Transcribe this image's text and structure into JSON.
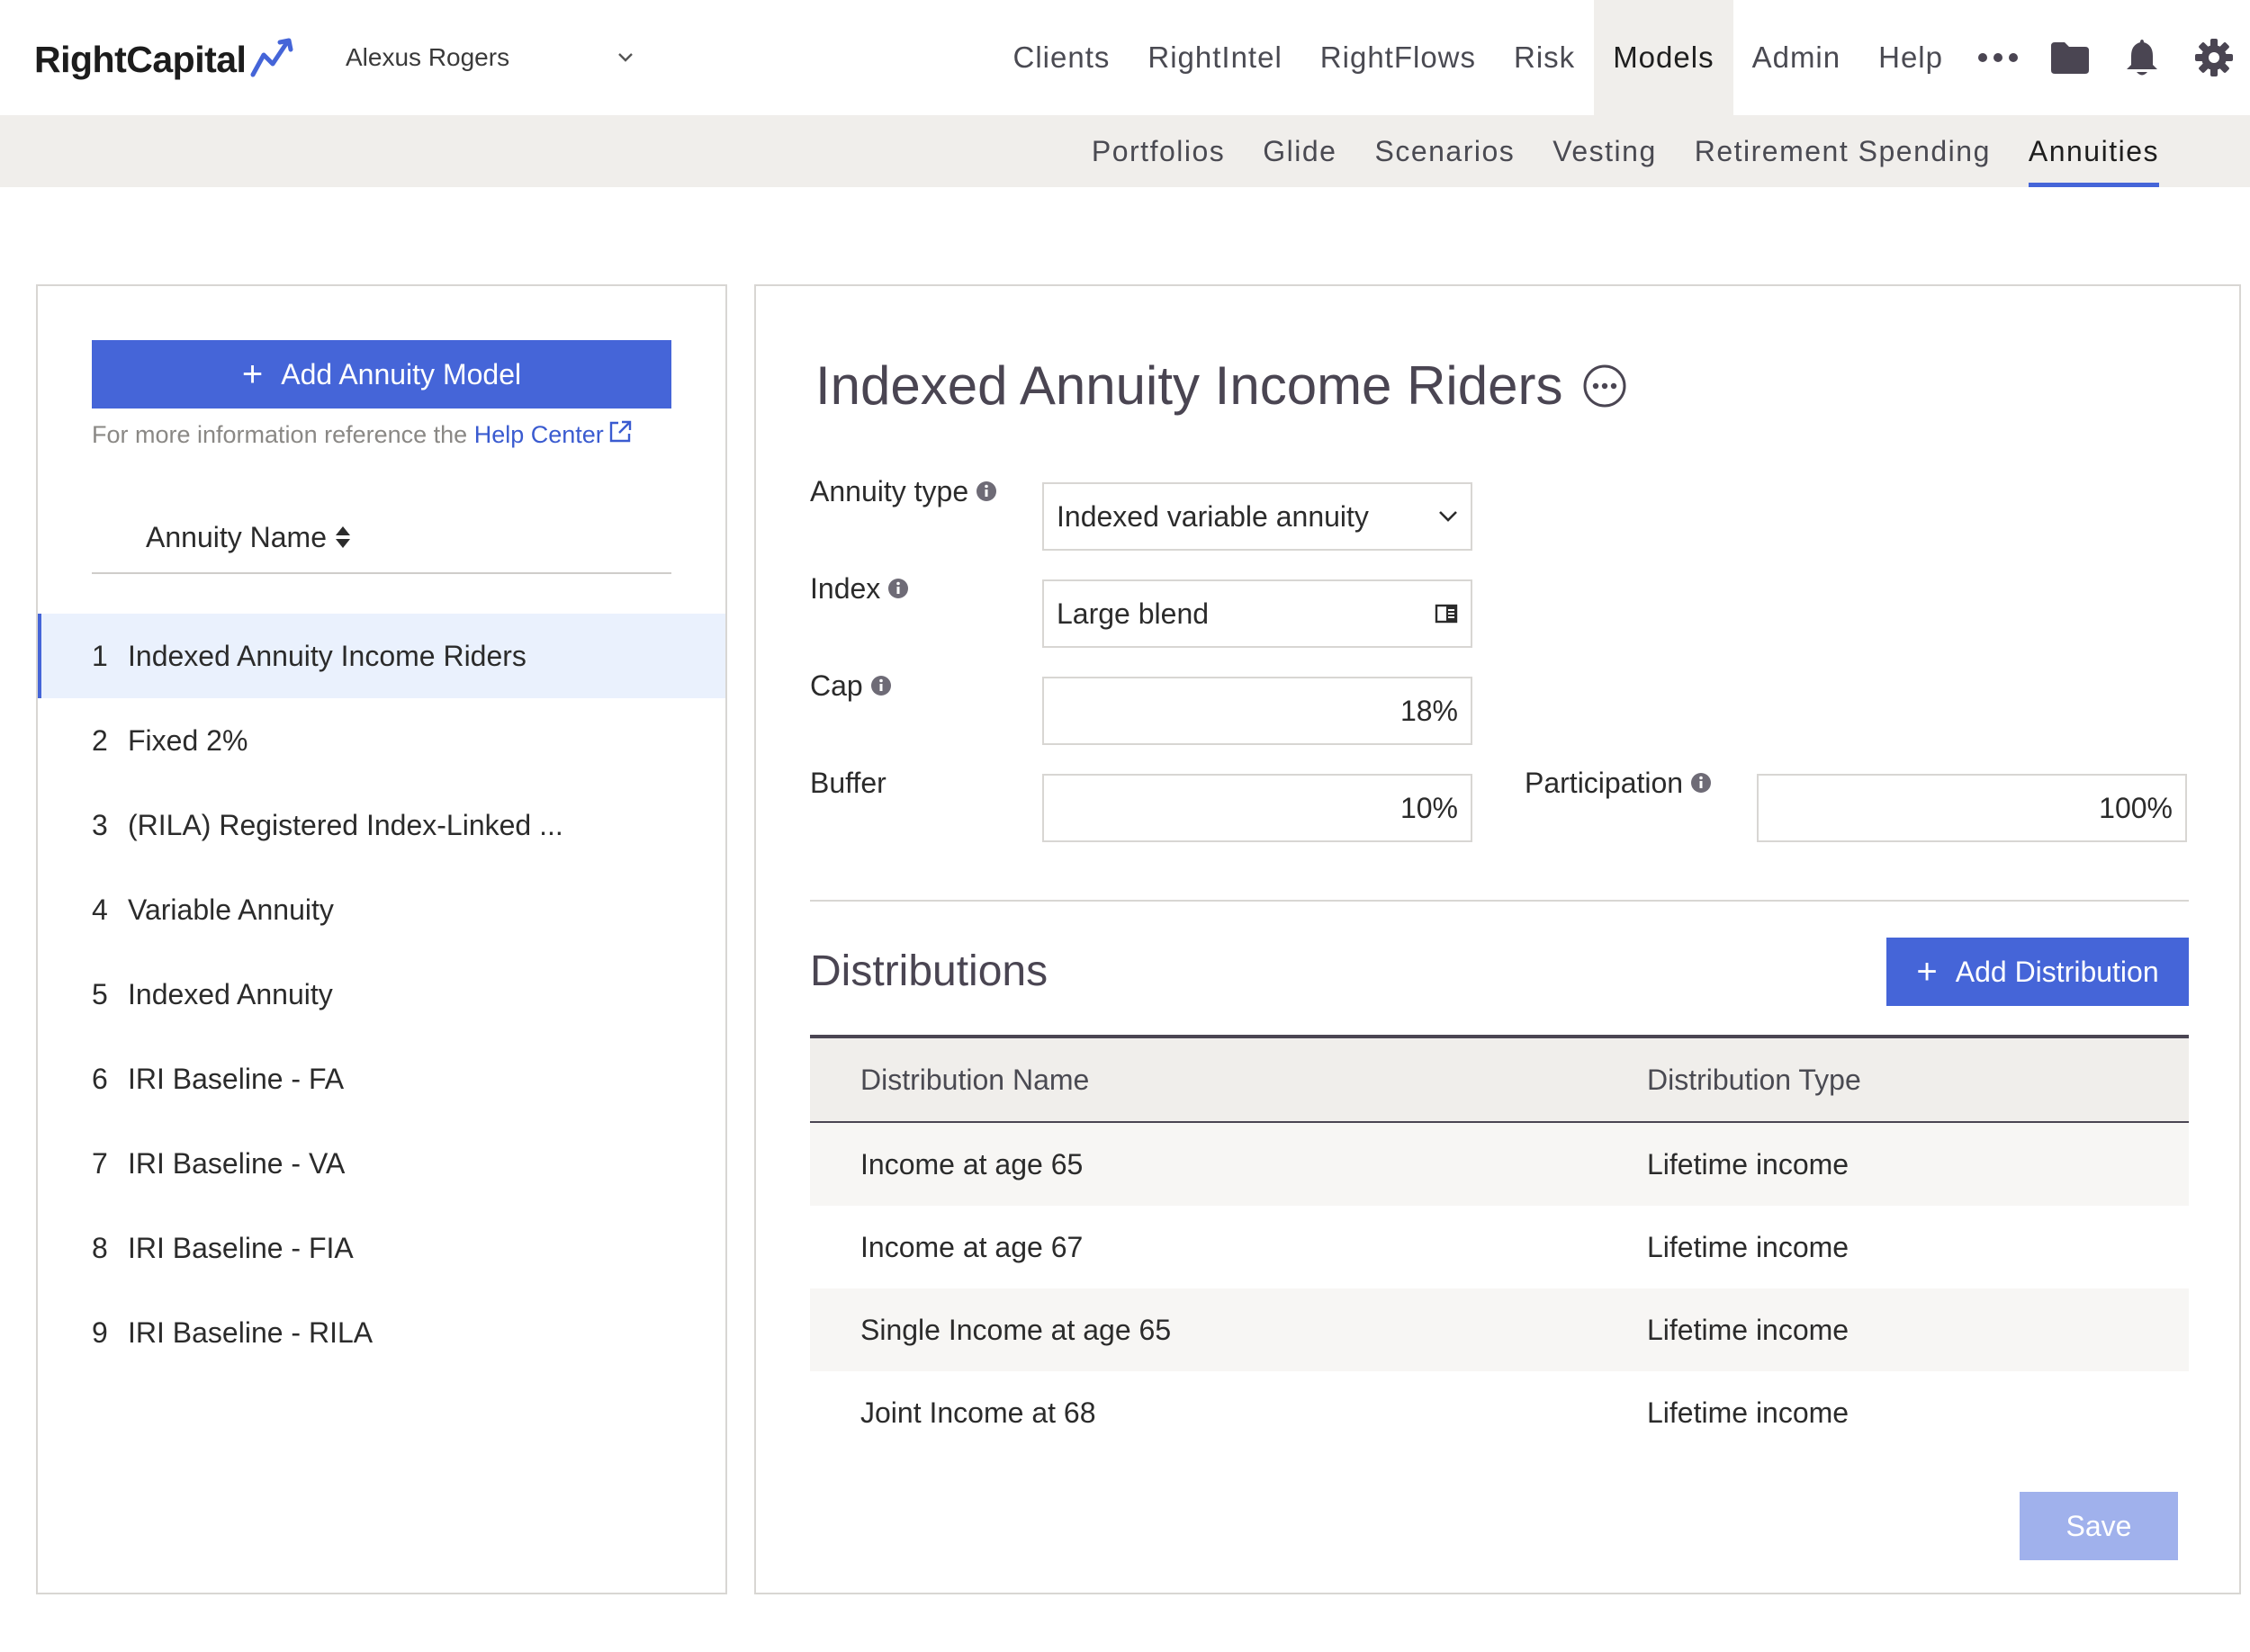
{
  "brand": {
    "name": "RightCapital",
    "accent": "#4565d8"
  },
  "client_selector": {
    "name": "Alexus Rogers",
    "icon": "chevron-down-icon"
  },
  "top_nav": {
    "items": [
      "Clients",
      "RightIntel",
      "RightFlows",
      "Risk",
      "Models",
      "Admin",
      "Help"
    ],
    "active": "Models",
    "icons": [
      "more-icon",
      "folder-icon",
      "bell-icon",
      "gear-icon"
    ]
  },
  "sub_nav": {
    "items": [
      "Portfolios",
      "Glide",
      "Scenarios",
      "Vesting",
      "Retirement Spending",
      "Annuities"
    ],
    "active": "Annuities"
  },
  "sidebar": {
    "add_button": "Add Annuity Model",
    "help_text": "For more information reference the",
    "help_link": "Help Center",
    "column_header": "Annuity Name",
    "selected_index": 0,
    "annuities": [
      {
        "num": "1",
        "name": "Indexed Annuity Income Riders"
      },
      {
        "num": "2",
        "name": "Fixed 2%"
      },
      {
        "num": "3",
        "name": "(RILA) Registered Index-Linked ..."
      },
      {
        "num": "4",
        "name": "Variable Annuity"
      },
      {
        "num": "5",
        "name": "Indexed Annuity"
      },
      {
        "num": "6",
        "name": "IRI Baseline - FA"
      },
      {
        "num": "7",
        "name": "IRI Baseline - VA"
      },
      {
        "num": "8",
        "name": "IRI Baseline - FIA"
      },
      {
        "num": "9",
        "name": "IRI Baseline - RILA"
      }
    ]
  },
  "detail": {
    "title": "Indexed Annuity Income Riders",
    "fields": {
      "annuity_type": {
        "label": "Annuity type",
        "value": "Indexed variable annuity"
      },
      "index": {
        "label": "Index",
        "value": "Large blend"
      },
      "cap": {
        "label": "Cap",
        "value": "18%"
      },
      "buffer": {
        "label": "Buffer",
        "value": "10%"
      },
      "participation": {
        "label": "Participation",
        "value": "100%"
      }
    },
    "distributions": {
      "title": "Distributions",
      "add_button": "Add Distribution",
      "columns": [
        "Distribution Name",
        "Distribution Type"
      ],
      "rows": [
        [
          "Income at age 65",
          "Lifetime income"
        ],
        [
          "Income at age 67",
          "Lifetime income"
        ],
        [
          "Single Income at age 65",
          "Lifetime income"
        ],
        [
          "Joint Income at 68",
          "Lifetime income"
        ]
      ]
    },
    "save_button": "Save"
  }
}
